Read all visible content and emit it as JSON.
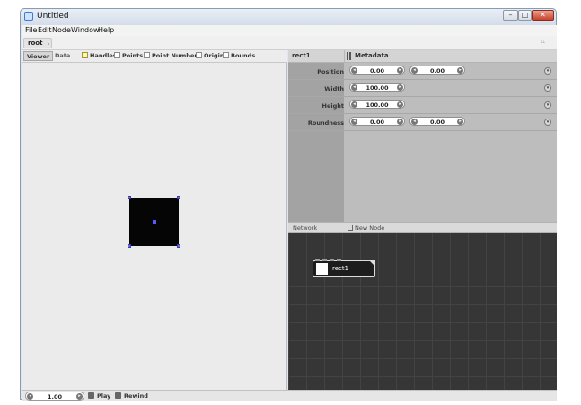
{
  "window": {
    "title": "Untitled",
    "minimize": "–",
    "maximize": "□",
    "close": "✕"
  },
  "menu": [
    "File",
    "Edit",
    "Node",
    "Window",
    "Help"
  ],
  "breadcrumb": {
    "root": "root"
  },
  "viewer": {
    "tabs": [
      "Viewer",
      "Data"
    ],
    "options": [
      {
        "label": "Handles",
        "checked": true
      },
      {
        "label": "Points",
        "checked": false
      },
      {
        "label": "Point Numbers",
        "checked": false
      },
      {
        "label": "Origin",
        "checked": false
      },
      {
        "label": "Bounds",
        "checked": false
      }
    ]
  },
  "panel": {
    "node_name": "rect1",
    "metadata_label": "Metadata"
  },
  "properties": [
    {
      "label": "Position",
      "values": [
        "0.00",
        "0.00"
      ]
    },
    {
      "label": "Width",
      "values": [
        "100.00"
      ]
    },
    {
      "label": "Height",
      "values": [
        "100.00"
      ]
    },
    {
      "label": "Roundness",
      "values": [
        "0.00",
        "0.00"
      ]
    }
  ],
  "network": {
    "title": "Network",
    "new_node": "New Node",
    "nodes": [
      {
        "name": "rect1"
      }
    ]
  },
  "playback": {
    "frame": "1.00",
    "play": "Play",
    "rewind": "Rewind"
  },
  "icons": {
    "app": "app-icon",
    "menu": "row-menu-icon",
    "step_left": "step-left-icon",
    "step_right": "step-right-icon",
    "play": "play-icon",
    "rewind": "rewind-icon"
  },
  "colors": {
    "canvas": "#ebebeb",
    "network": "#363636",
    "shape": "#050505",
    "handle": "#6d6dd6"
  }
}
